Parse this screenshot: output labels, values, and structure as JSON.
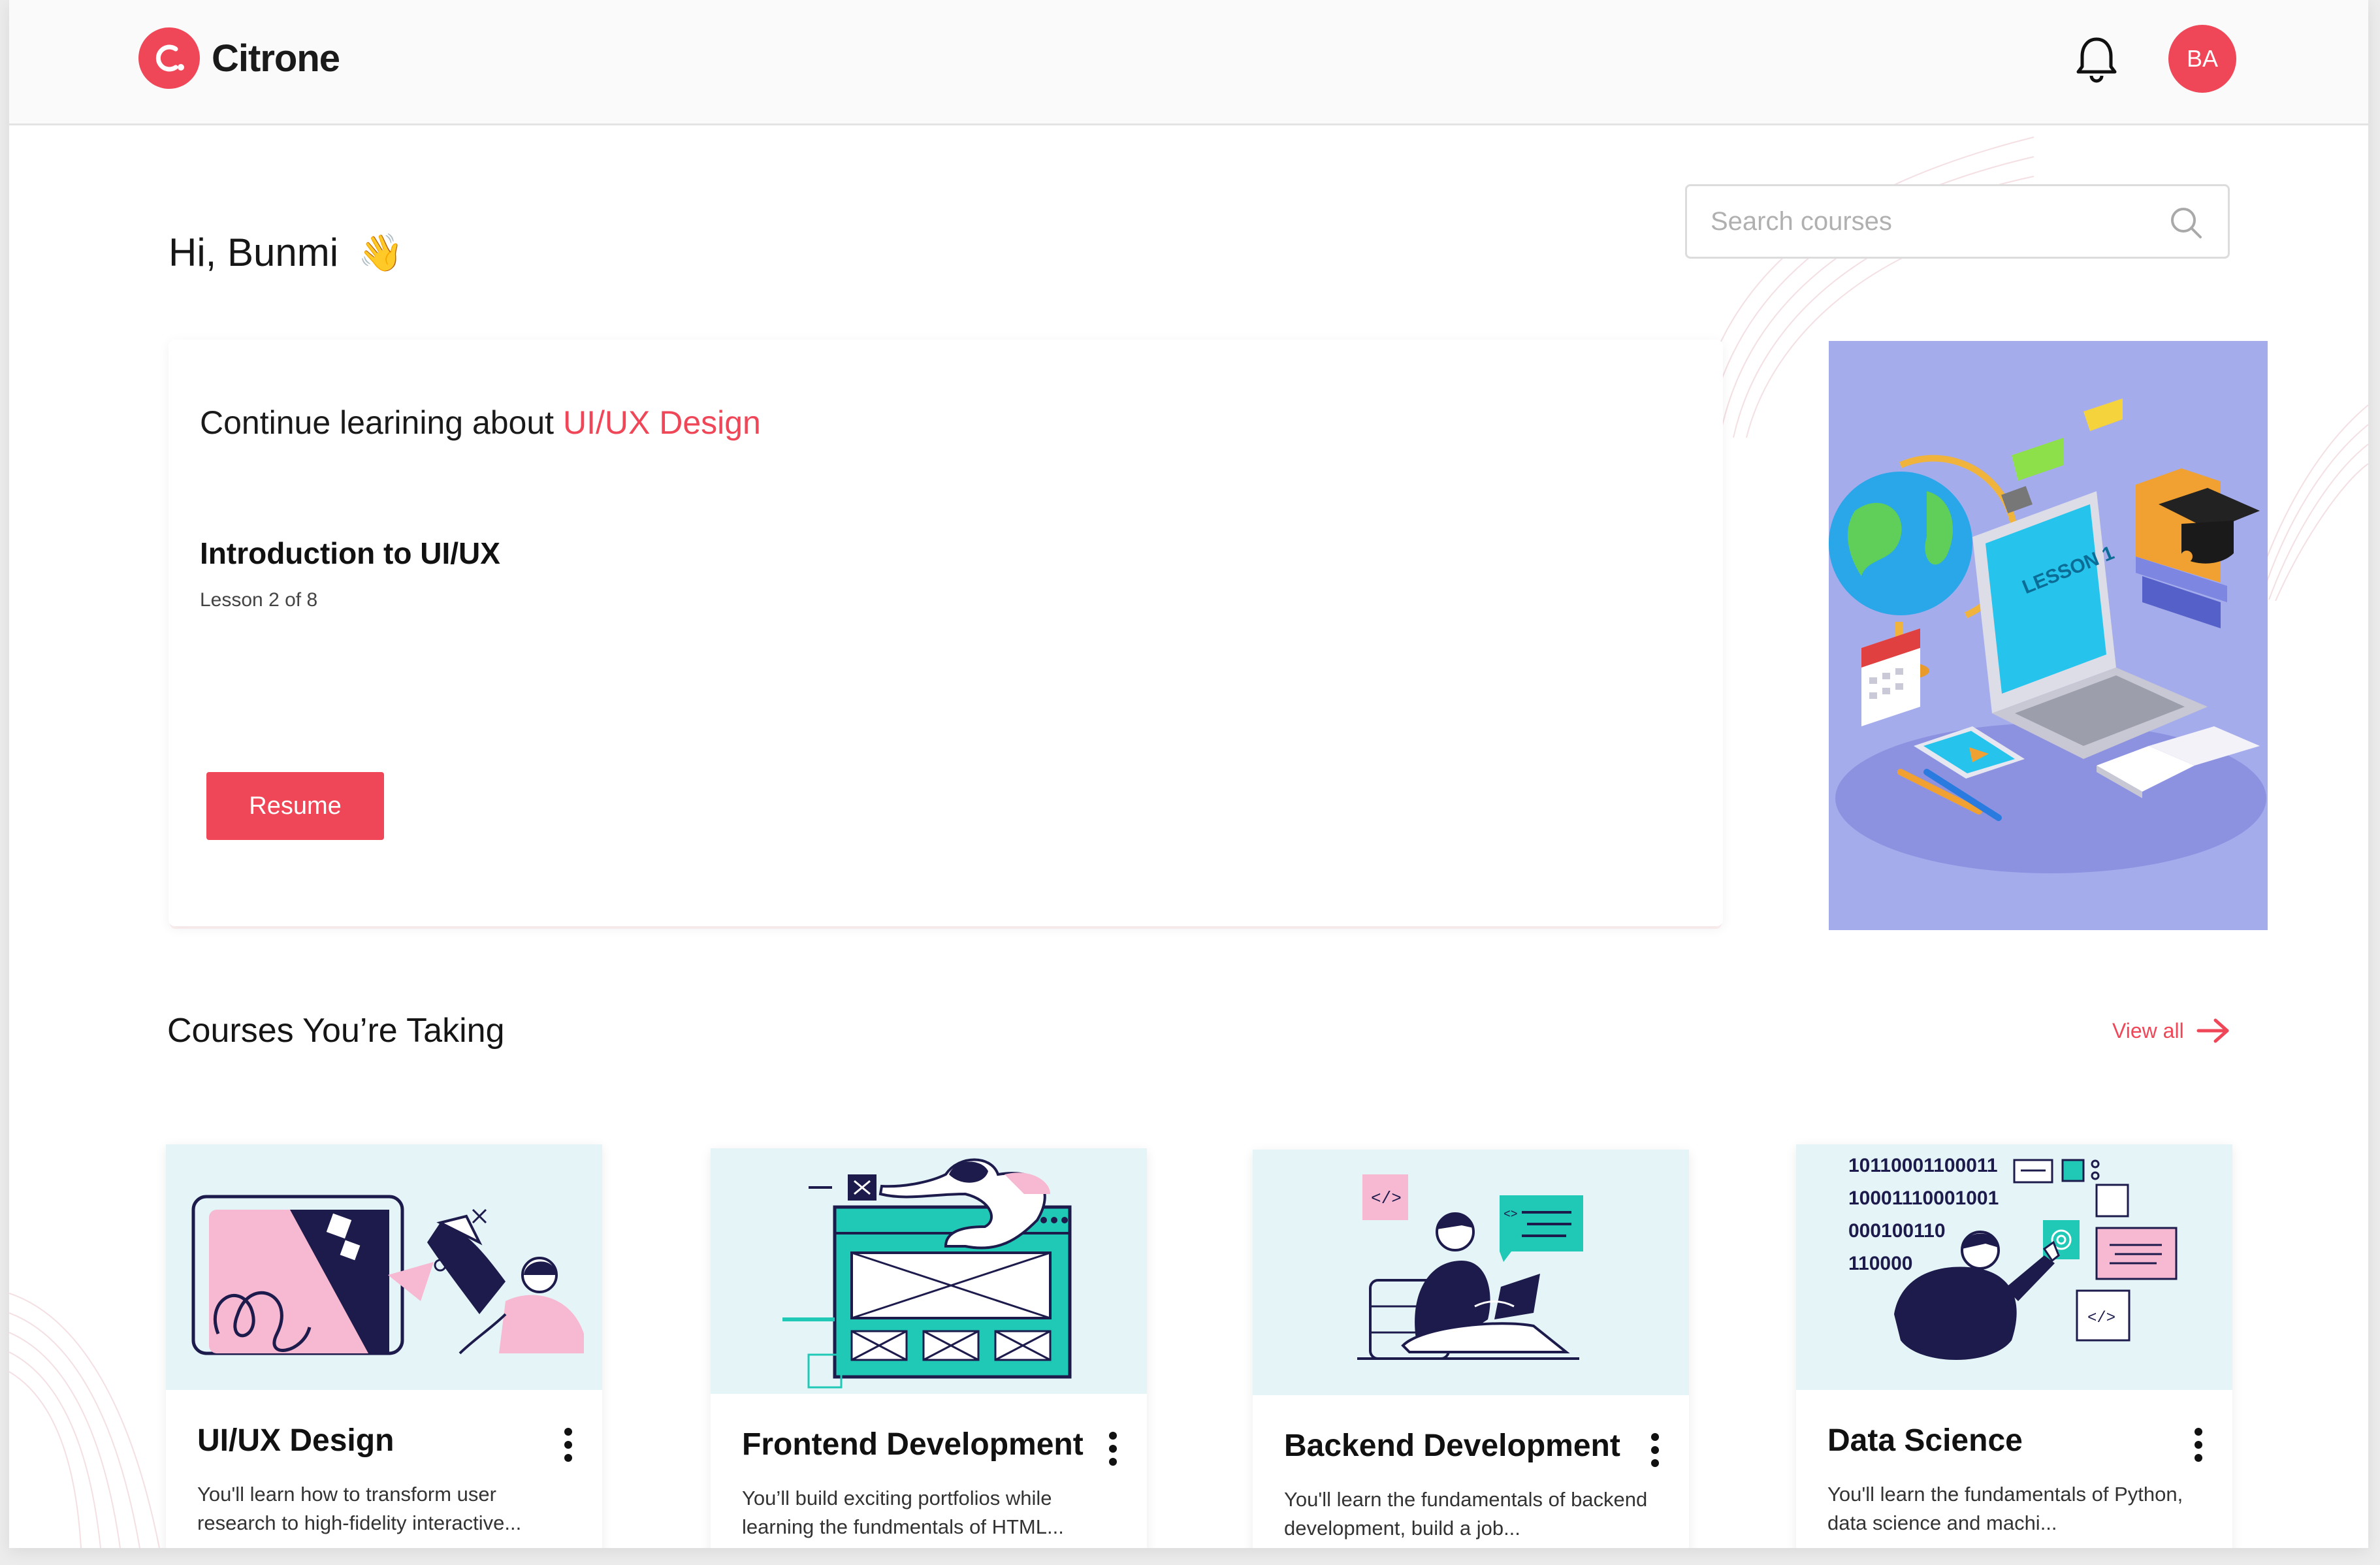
{
  "header": {
    "brand_name": "Citrone",
    "avatar_initials": "BA",
    "icons": {
      "notifications": "bell-icon",
      "logo": "citrone-logo-icon"
    }
  },
  "greeting": {
    "text": "Hi, Bunmi",
    "emoji": "👋"
  },
  "search": {
    "placeholder": "Search courses",
    "value": "",
    "icon": "search-icon"
  },
  "continue": {
    "heading_prefix": "Continue learining about",
    "topic": "UI/UX Design",
    "lesson_title": "Introduction to UI/UX",
    "lesson_progress": "Lesson 2 of 8",
    "resume_label": "Resume"
  },
  "hero": {
    "screen_text": "LESSON 1"
  },
  "courses": {
    "heading": "Courses You’re Taking",
    "view_all_label": "View all",
    "items": [
      {
        "title": "UI/UX Design",
        "description": "You'll learn how to transform user research to high-fidelity interactive..."
      },
      {
        "title": "Frontend Development",
        "description": "You’ll build exciting portfolios while learning the fundmentals of HTML..."
      },
      {
        "title": "Backend Development",
        "description": "You'll learn the fundamentals of backend development, build a job..."
      },
      {
        "title": "Data Science",
        "description": "You'll learn the fundamentals of Python, data science and machi..."
      }
    ],
    "data_science_binary": [
      "10110001100011",
      "10001110001001",
      "000100110",
      "110000"
    ]
  },
  "colors": {
    "accent": "#ef4758",
    "hero_bg": "#a4acec",
    "thumb_bg": "#e5f4f7",
    "teal": "#1fc9b6",
    "navy": "#1d1b4c",
    "pink": "#f7b8d2"
  }
}
